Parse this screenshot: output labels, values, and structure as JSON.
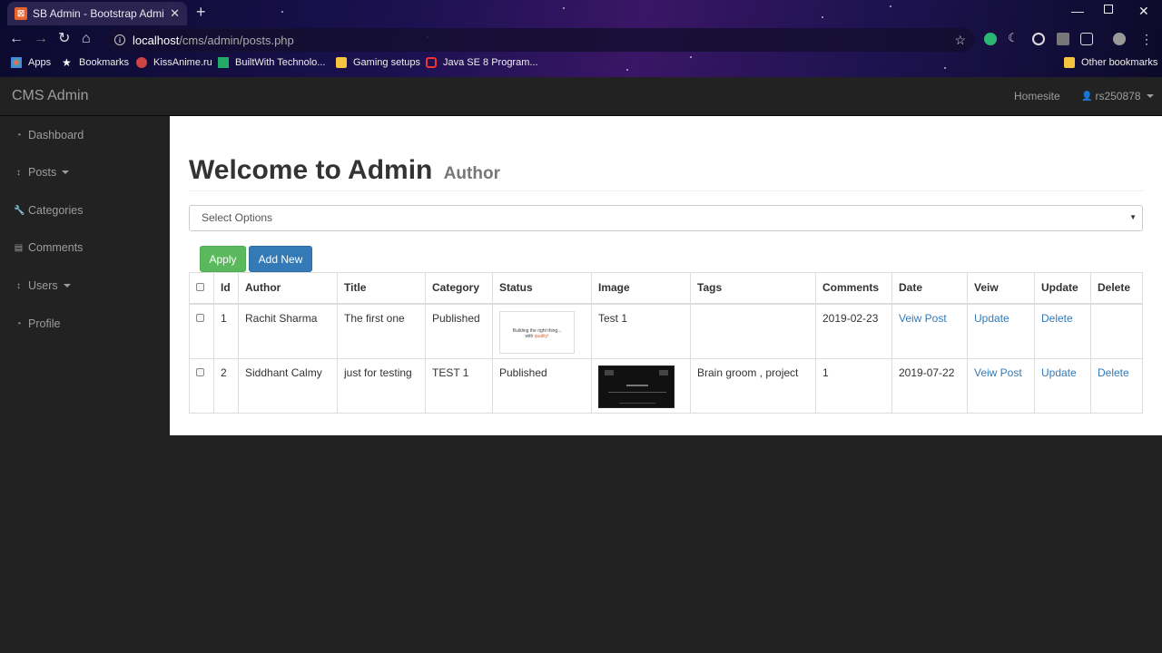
{
  "browser": {
    "tab_title": "SB Admin - Bootstrap Admin Ten",
    "url_host": "localhost",
    "url_path": "/cms/admin/posts.php",
    "bookmarks": [
      "Apps",
      "Bookmarks",
      "KissAnime.ru",
      "BuiltWith Technolo...",
      "Gaming setups",
      "Java SE 8 Program..."
    ],
    "other_bookmarks": "Other bookmarks"
  },
  "app": {
    "brand": "CMS Admin",
    "homesite": "Homesite",
    "user": "rs250878"
  },
  "sidebar": {
    "items": [
      {
        "label": "Dashboard",
        "icon": "dashboard-icon"
      },
      {
        "label": "Posts",
        "icon": "arrows-v-icon"
      },
      {
        "label": "Categories",
        "icon": "wrench-icon"
      },
      {
        "label": "Comments",
        "icon": "file-icon"
      },
      {
        "label": "Users",
        "icon": "arrows-v-icon"
      },
      {
        "label": "Profile",
        "icon": "dashboard-icon"
      }
    ]
  },
  "main": {
    "heading": "Welcome to Admin",
    "heading_small": "Author",
    "select_value": "Select Options",
    "apply_label": "Apply",
    "add_new_label": "Add New"
  },
  "table": {
    "headers": [
      "Id",
      "Author",
      "Title",
      "Category",
      "Status",
      "Image",
      "Tags",
      "Comments",
      "Date",
      "Veiw",
      "Update",
      "Delete"
    ],
    "rows": [
      {
        "id": "1",
        "author": "Rachit Sharma",
        "title": "The first one",
        "category": "Published",
        "image_text_a": "Building the right thing...",
        "image_text_b": "with ",
        "image_text_c": "quality!",
        "tags": "Test 1",
        "comments": "",
        "date": "2019-02-23",
        "view": "Veiw Post",
        "update": "Update",
        "delete": "Delete"
      },
      {
        "id": "2",
        "author": "Siddhant Calmy",
        "title": "just for testing",
        "category": "TEST 1",
        "status": "Published",
        "tags": "Brain groom , project",
        "comments": "1",
        "date": "2019-07-22",
        "view": "Veiw Post",
        "update": "Update",
        "delete": "Delete"
      }
    ]
  }
}
